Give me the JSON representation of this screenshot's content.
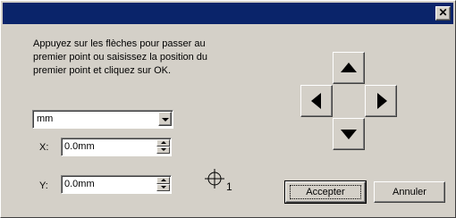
{
  "window": {
    "close_label": "✕"
  },
  "instructions": "Appuyez sur les flèches pour passer au\npremier point ou saisissez la position du\npremier point et cliquez sur OK.",
  "unit": {
    "selected": "mm"
  },
  "x_field": {
    "label": "X:",
    "value": "0.0mm"
  },
  "y_field": {
    "label": "Y:",
    "value": "0.0mm"
  },
  "point_marker": {
    "icon": "crosshair-icon",
    "index": "1"
  },
  "buttons": {
    "accept": "Accepter",
    "cancel": "Annuler"
  },
  "colors": {
    "titlebar": "#0a246a",
    "face": "#d4d0c8"
  }
}
